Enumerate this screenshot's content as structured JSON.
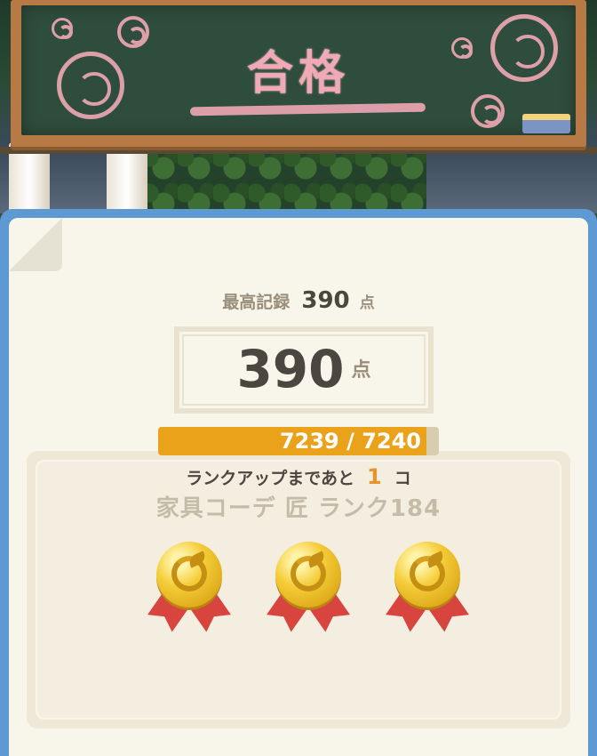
{
  "board": {
    "title": "合格"
  },
  "result": {
    "best_label": "最高記録",
    "best_score": "390",
    "point_unit": "点",
    "score": "390"
  },
  "rank": {
    "name": "家具コーデ 匠 ランク184",
    "medals": [
      "bell-medal-icon",
      "bell-medal-icon",
      "bell-medal-icon"
    ],
    "progress_text": "7239 / 7240",
    "progress_fraction": 0.99986,
    "next_prefix": "ランクアップまであと",
    "next_count": "1",
    "next_suffix": "コ"
  },
  "colors": {
    "chalk_pink": "#f0a9b5",
    "board_green": "#2f4d3c",
    "panel_blue": "#5d99d2",
    "progress_fill": "#eaa21b",
    "count_orange": "#e8932b"
  }
}
